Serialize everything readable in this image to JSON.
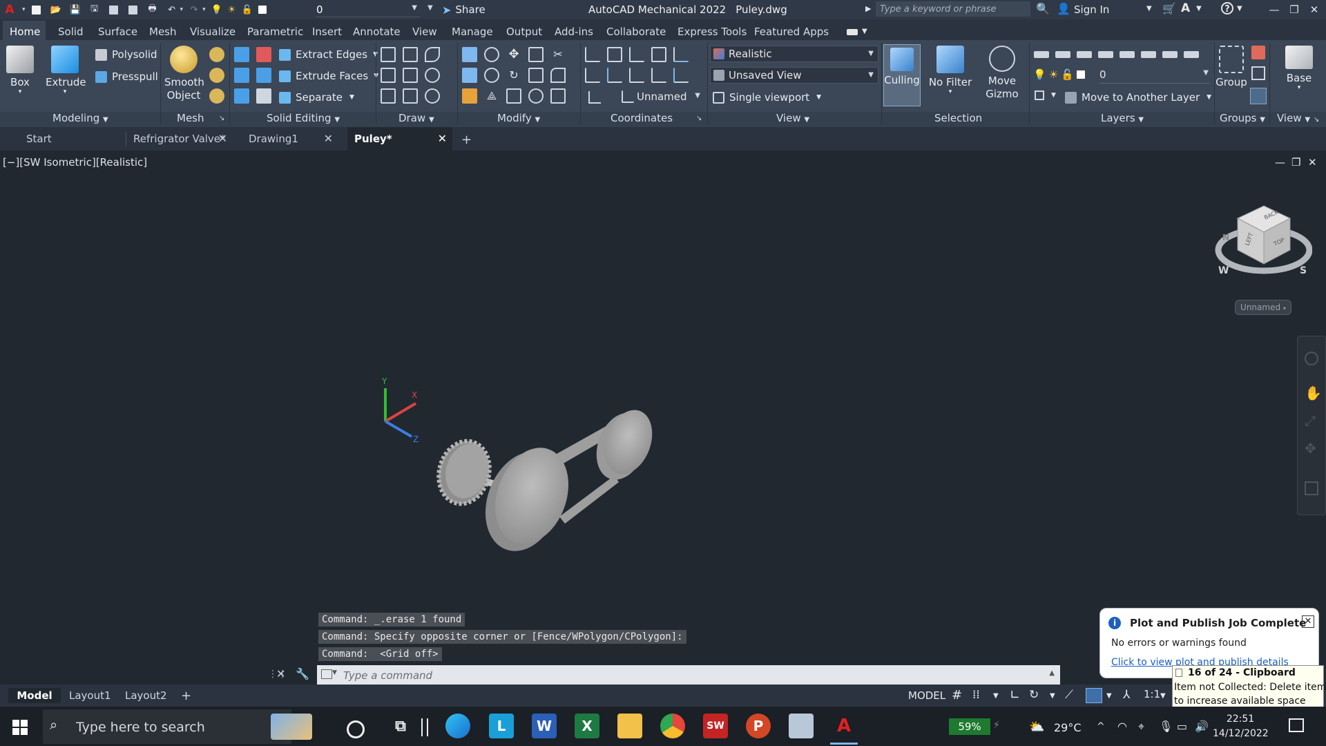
{
  "titlebar": {
    "app_name": "AutoCAD Mechanical 2022",
    "file_name": "Puley.dwg",
    "layer_value": "0",
    "share_label": "Share",
    "search_placeholder": "Type a keyword or phrase",
    "sign_in_label": "Sign In"
  },
  "ribbon_tabs": [
    "Home",
    "Solid",
    "Surface",
    "Mesh",
    "Visualize",
    "Parametric",
    "Insert",
    "Annotate",
    "View",
    "Manage",
    "Output",
    "Add-ins",
    "Collaborate",
    "Express Tools",
    "Featured Apps"
  ],
  "panels": {
    "modeling": {
      "title": "Modeling",
      "box": "Box",
      "extrude": "Extrude",
      "polysolid": "Polysolid",
      "presspull": "Presspull"
    },
    "mesh": {
      "title": "Mesh",
      "smooth_line1": "Smooth",
      "smooth_line2": "Object"
    },
    "solid_editing": {
      "title": "Solid Editing",
      "extract_edges": "Extract Edges",
      "extrude_faces": "Extrude Faces",
      "separate": "Separate"
    },
    "draw": {
      "title": "Draw"
    },
    "modify": {
      "title": "Modify"
    },
    "coordinates": {
      "title": "Coordinates",
      "ucs_value": "Unnamed"
    },
    "view": {
      "title": "View",
      "visual_style": "Realistic",
      "named_view": "Unsaved View",
      "viewport": "Single viewport"
    },
    "selection": {
      "title": "Selection",
      "culling": "Culling",
      "no_filter": "No Filter",
      "move_gizmo_line1": "Move",
      "move_gizmo_line2": "Gizmo"
    },
    "layers": {
      "title": "Layers",
      "layer_value": "0",
      "move_to_layer": "Move to Another Layer"
    },
    "groups": {
      "title": "Groups",
      "group": "Group"
    },
    "view2": {
      "title": "View",
      "base": "Base"
    }
  },
  "doc_tabs": [
    {
      "label": "Start",
      "closable": false
    },
    {
      "label": "Refrigrator Valve*",
      "closable": true
    },
    {
      "label": "Drawing1",
      "closable": true
    },
    {
      "label": "Puley*",
      "closable": true,
      "active": true
    }
  ],
  "viewport": {
    "label": "[−][SW Isometric][Realistic]",
    "viewcube_faces": {
      "top": "TOP",
      "left": "LEFT",
      "back": "BACK"
    },
    "compass": {
      "n": "N",
      "w": "W",
      "s": "S"
    },
    "ucs_label": "Unnamed",
    "axis": {
      "x": "X",
      "y": "Y",
      "z": "Z"
    }
  },
  "command_history": [
    "Command: _.erase 1 found",
    "Command: Specify opposite corner or [Fence/WPolygon/CPolygon]:",
    "Command:  <Grid off>"
  ],
  "command_placeholder": "Type a command",
  "layout_tabs": [
    "Model",
    "Layout1",
    "Layout2"
  ],
  "status": {
    "model": "MODEL",
    "scale": "1:1"
  },
  "notification": {
    "title": "Plot and Publish Job Complete",
    "body": "No errors or warnings found",
    "link": "Click to view plot and publish details"
  },
  "clipboard": {
    "title": "16 of 24 - Clipboard",
    "line1": "Item not Collected: Delete items",
    "line2": "to increase available space"
  },
  "taskbar": {
    "search_placeholder": "Type here to search",
    "battery": "59%",
    "temperature": "29°C",
    "time": "22:51",
    "date": "14/12/2022"
  },
  "colors": {
    "accent": "#1a9fff",
    "ribbon": "#3b4656",
    "canvas": "#212830",
    "model_grey": "#9a9a9a"
  }
}
